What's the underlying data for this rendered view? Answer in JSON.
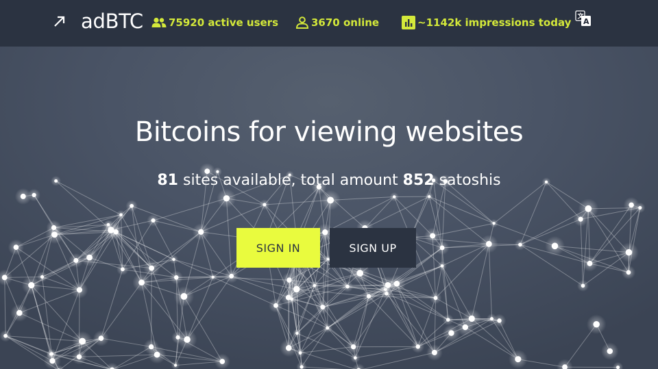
{
  "header": {
    "logo_text": "adBTC",
    "stats": {
      "users": "75920 active users",
      "online": "3670 online",
      "impressions": "~1142k impressions today"
    }
  },
  "hero": {
    "title": "Bitcoins for viewing websites",
    "sites_count": "81",
    "sites_text": " sites available, total amount ",
    "amount": "852",
    "unit_text": " satoshis"
  },
  "buttons": {
    "sign_in": "SIGN IN",
    "sign_up": "SIGN UP"
  },
  "colors": {
    "header_bg": "#2b3341",
    "accent": "#d4e93a",
    "sign_in_bg": "#e9fb3e",
    "hero_bg": "#414b5c"
  },
  "icons": {
    "logo": "arrow-up-right-icon",
    "users": "users-icon",
    "online": "user-icon",
    "impressions": "bar-chart-icon",
    "language": "translate-icon"
  }
}
